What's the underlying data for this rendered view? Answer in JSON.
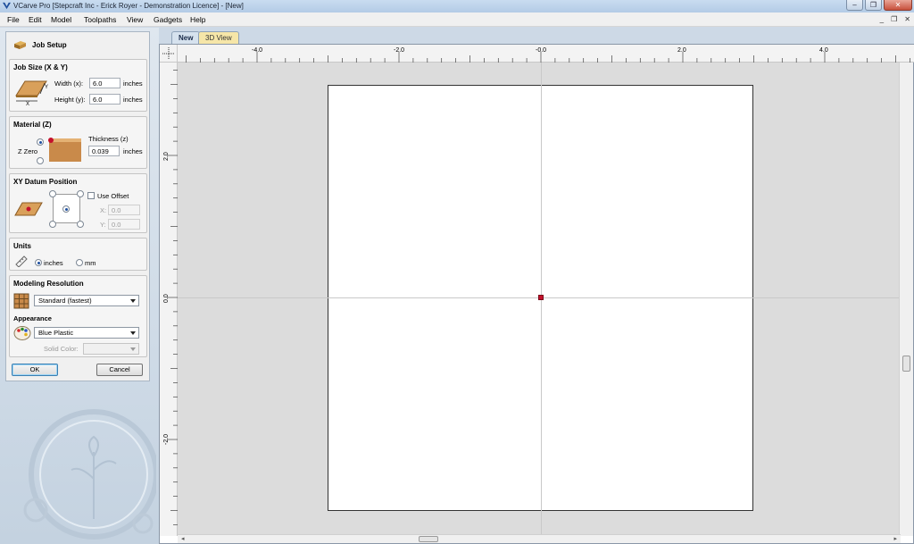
{
  "window": {
    "title": "VCarve Pro [Stepcraft Inc - Erick Royer - Demonstration Licence] - [New]",
    "minimize": "‒",
    "restore": "❐",
    "close": "✕"
  },
  "menu": {
    "items": [
      "File",
      "Edit",
      "Model",
      "Toolpaths",
      "View",
      "Gadgets",
      "Help"
    ],
    "mdi_min": "_",
    "mdi_restore": "❐",
    "mdi_close": "✕"
  },
  "tabs": {
    "active": "New",
    "other": "3D View"
  },
  "job_setup": {
    "header": "Job Setup",
    "job_size": {
      "title": "Job Size (X & Y)",
      "width_label": "Width (x):",
      "width_value": "6.0",
      "height_label": "Height (y):",
      "height_value": "6.0",
      "unit": "inches",
      "x_glyph": "X",
      "y_glyph": "Y"
    },
    "material": {
      "title": "Material (Z)",
      "zzero_label": "Z Zero",
      "thickness_label": "Thickness (z)",
      "thickness_value": "0.039",
      "unit": "inches",
      "zzero_top_selected": true
    },
    "datum": {
      "title": "XY Datum Position",
      "use_offset_label": "Use Offset",
      "use_offset_checked": false,
      "x_label": "X:",
      "x_value": "0.0",
      "y_label": "Y:",
      "y_value": "0.0",
      "selected": "center"
    },
    "units": {
      "title": "Units",
      "inches_label": "inches",
      "mm_label": "mm",
      "selected": "inches"
    },
    "resolution": {
      "title": "Modeling Resolution",
      "selected": "Standard (fastest)"
    },
    "appearance": {
      "title": "Appearance",
      "selected": "Blue Plastic",
      "solid_color_label": "Solid Color:"
    },
    "ok_label": "OK",
    "cancel_label": "Cancel"
  },
  "rulers": {
    "h_labels": [
      "-4.0",
      "-2.0",
      "-0.0",
      "2.0",
      "4.0"
    ],
    "v_labels": [
      "2.0",
      "0.0",
      "-2.0"
    ]
  },
  "colors": {
    "origin": "#c4102c",
    "workarea": "#dcdcdc",
    "sheet": "#ffffff"
  }
}
